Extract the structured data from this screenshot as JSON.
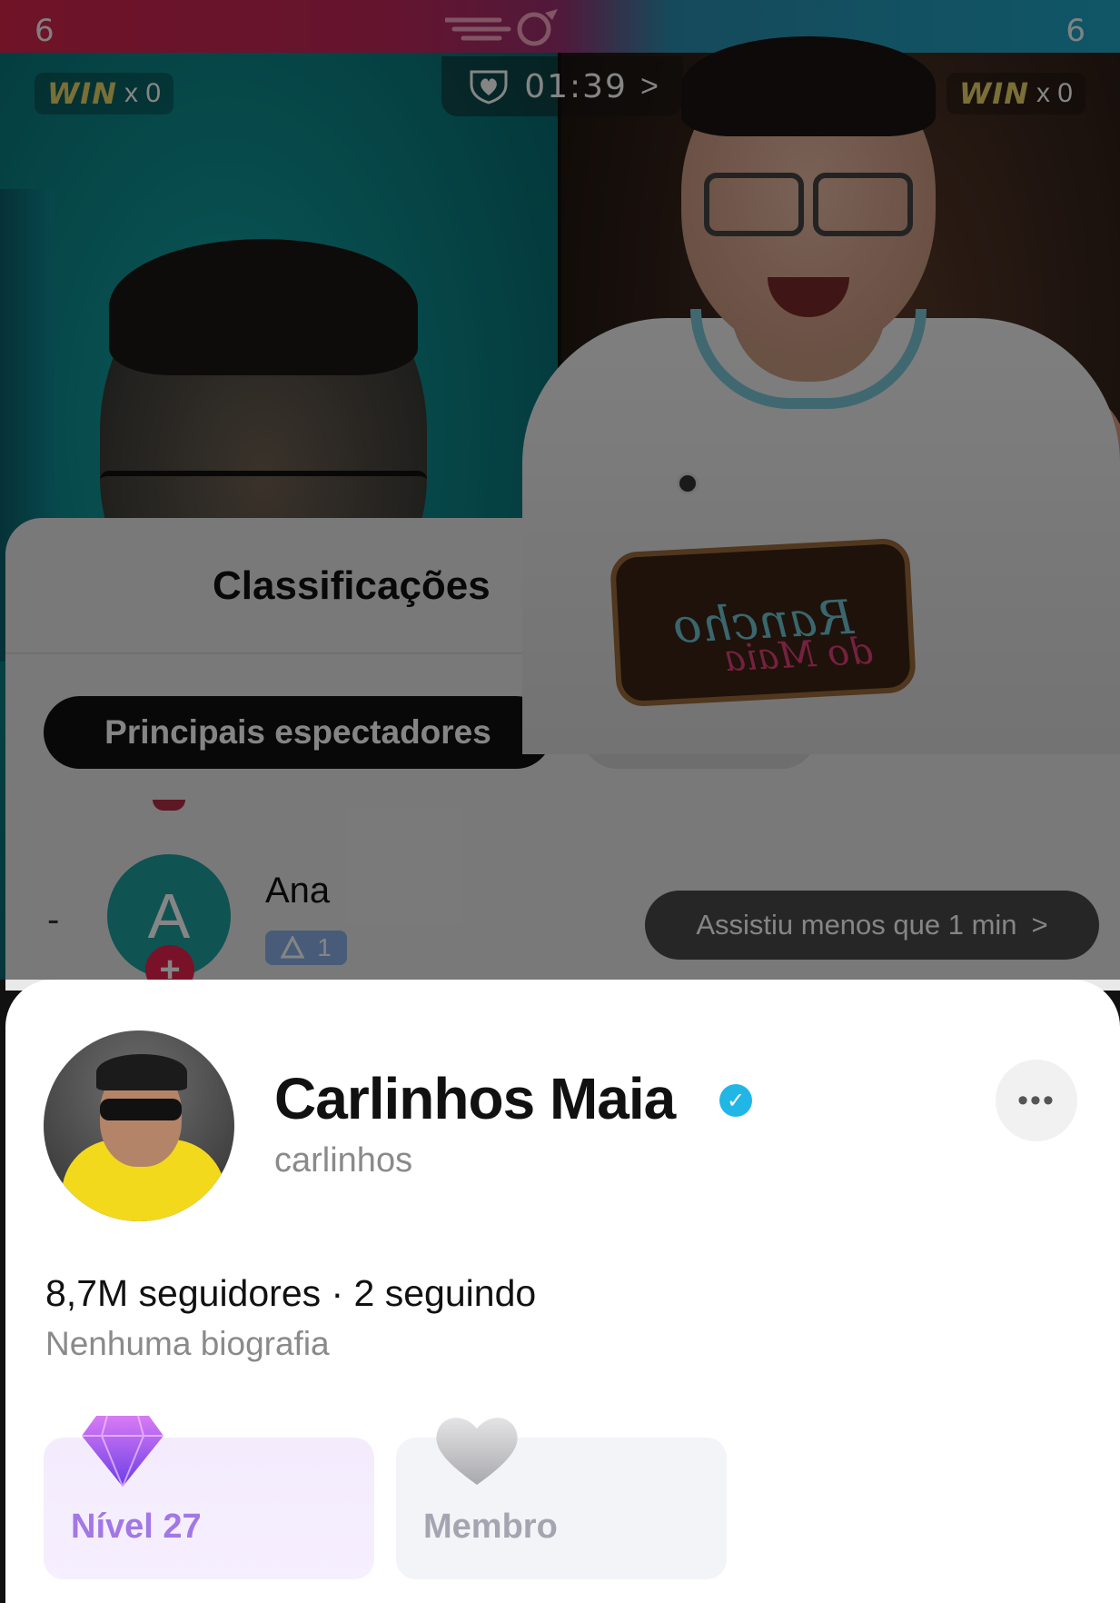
{
  "battle": {
    "score_left": "6",
    "score_right": "6",
    "win_label": "WIN",
    "win_left": "x 0",
    "win_right": "x 0",
    "timer": "01:39",
    "timer_chevron": ">"
  },
  "overlay_logo": {
    "text": "Rancho",
    "sub": "do Maia"
  },
  "rankings": {
    "title": "Classificações",
    "active_tab": "Principais espectadores",
    "row": {
      "rank": "-",
      "avatar_letter": "A",
      "plus": "+",
      "name": "Ana",
      "badge_level": "1",
      "watched": "Assistiu menos que 1 min",
      "chevron": ">"
    }
  },
  "profile": {
    "name": "Carlinhos Maia",
    "verified": "✓",
    "handle": "carlinhos",
    "more": "•••",
    "stats": "8,7M seguidores · 2 seguindo",
    "bio": "Nenhuma biografia",
    "cards": {
      "level_label": "Nível 27",
      "member_label": "Membro"
    }
  },
  "colors": {
    "red_team": "#d6254c",
    "blue_team": "#1fa6c4",
    "verified": "#20b6e6",
    "level_text": "#a277e6"
  }
}
